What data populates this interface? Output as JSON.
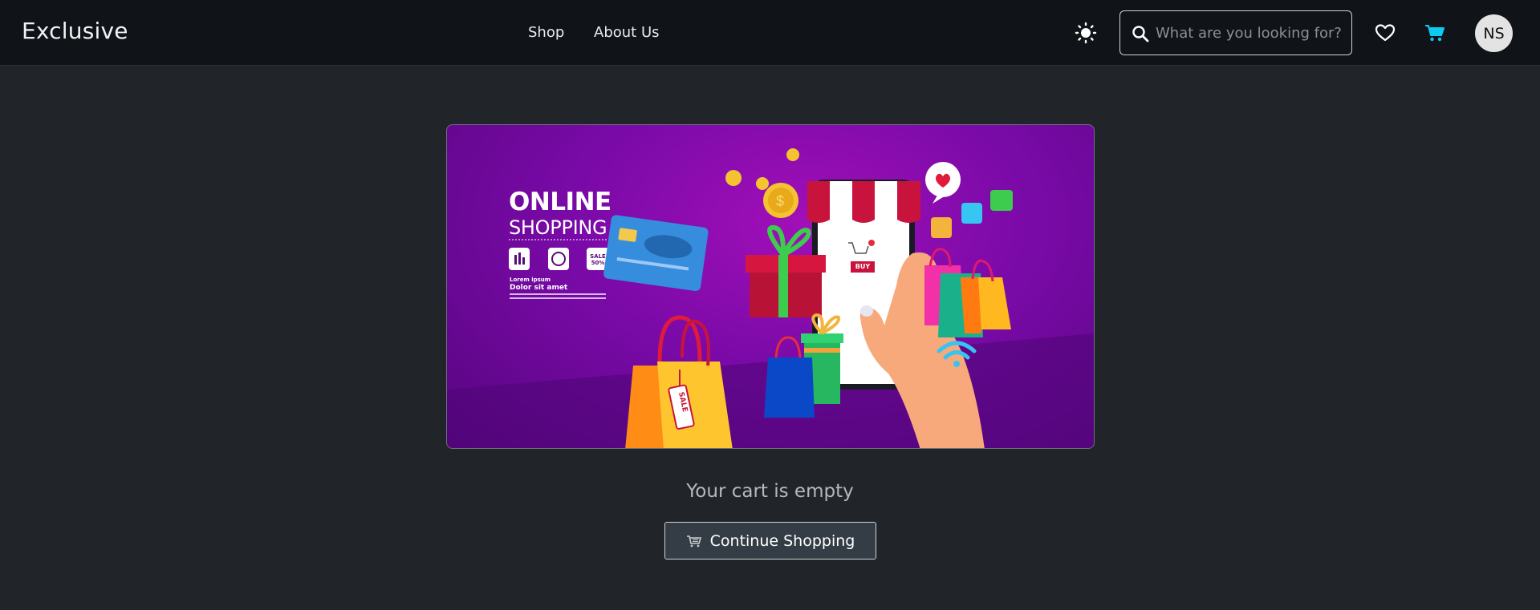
{
  "navbar": {
    "brand": "Exclusive",
    "links": [
      {
        "label": "Shop"
      },
      {
        "label": "About Us"
      }
    ],
    "theme_icon": "sun-icon",
    "search": {
      "placeholder": "What are you looking for?",
      "value": "",
      "icon": "search-icon"
    },
    "wishlist_icon": "heart-icon",
    "cart_icon": "cart-icon",
    "avatar_initials": "NS",
    "accent_color": "#0dcaf0"
  },
  "banner": {
    "title_line1": "ONLINE",
    "title_line2": "SHOPPING",
    "sale_badge": "SALE 50%",
    "subtitle_small": "Lorem ipsum",
    "subtitle": "Dolor sit amet",
    "phone_button": "BUY",
    "bag_tag": "SALE"
  },
  "empty_state": {
    "message": "Your cart is empty",
    "button_label": "Continue Shopping",
    "button_icon": "cart-icon"
  }
}
